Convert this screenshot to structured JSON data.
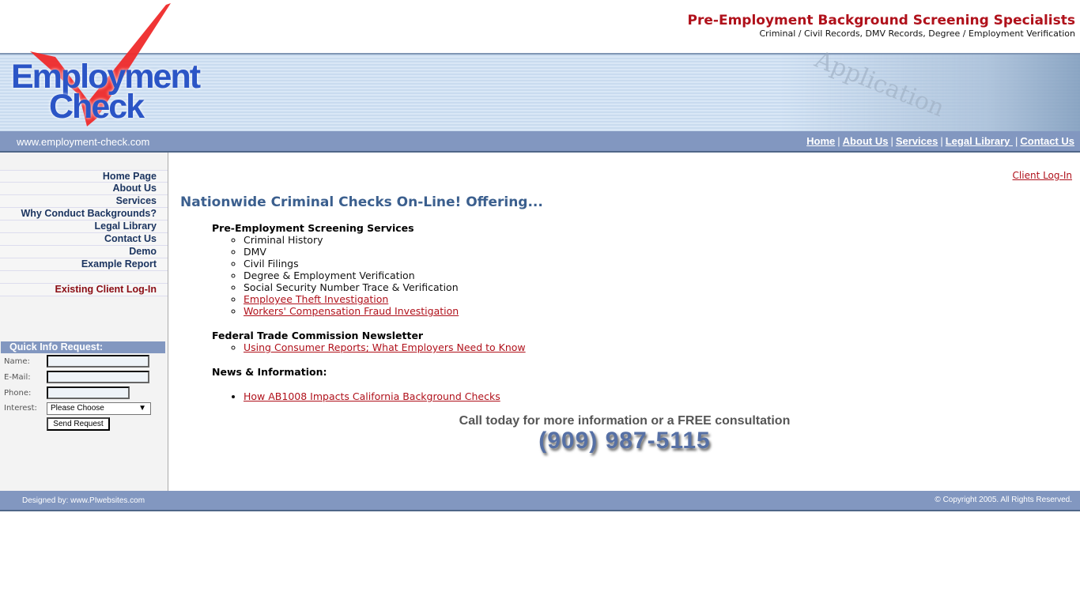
{
  "header": {
    "logo_line1": "Employment",
    "logo_line2": "Check",
    "tagline": "Pre-Employment Background Screening Specialists",
    "subtagline": "Criminal / Civil Records, DMV Records, Degree / Employment Verification",
    "banner_text": "Application",
    "url": "www.employment-check.com",
    "nav": [
      "Home",
      "About Us",
      "Services",
      "Legal Library ",
      "Contact Us"
    ],
    "nav_sep": "|"
  },
  "sidebar": {
    "items": [
      "Home Page",
      "About Us",
      "Services",
      "Why Conduct Backgrounds?",
      "Legal Library",
      "Contact Us",
      "Demo",
      "Example Report"
    ],
    "client_login": "Existing Client Log-In",
    "form": {
      "title": "Quick Info Request:",
      "name_label": "Name:",
      "email_label": "E-Mail:",
      "phone_label": "Phone:",
      "interest_label": "Interest:",
      "interest_value": "Please Choose",
      "submit": "Send Request"
    }
  },
  "main": {
    "client_login": "Client Log-In",
    "headline": "Nationwide Criminal Checks On-Line! Offering...",
    "section1": {
      "title": "Pre-Employment Screening Services",
      "items": [
        "Criminal History",
        "DMV",
        "Civil Filings",
        "Degree & Employment Verification",
        "Social Security Number Trace & Verification"
      ],
      "links": [
        "Employee Theft Investigation",
        "Workers' Compensation Fraud Investigation"
      ]
    },
    "section2": {
      "title": "Federal Trade Commission Newsletter",
      "links": [
        "Using Consumer Reports; What Employers Need to Know"
      ]
    },
    "section3": {
      "title": "News & Information:",
      "links": [
        "How AB1008 Impacts California Background Checks"
      ]
    },
    "cta": "Call today for more information or a FREE consultation",
    "phone": "(909) 987-5115"
  },
  "footer": {
    "designed_by": "Designed by: www.PIwebsites.com",
    "copyright": "© Copyright 2005.  All Rights Reserved."
  },
  "colors": {
    "accent_red": "#b0111b",
    "nav_blue": "#8297c0",
    "headline_blue": "#3b5f8e"
  }
}
